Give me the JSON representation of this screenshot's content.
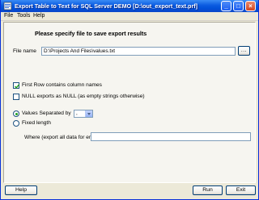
{
  "window": {
    "title": "Export Table to Text for SQL Server DEMO [D:\\out_export_text.prf]"
  },
  "menu": {
    "items": [
      "File",
      "Tools",
      "Help"
    ]
  },
  "main": {
    "heading": "Please specify file to save export results",
    "file_name_label": "File name",
    "file_name_value": "D:\\Projects And Files\\values.txt",
    "browse_label": "...",
    "first_row_label": "First Row contains column names",
    "first_row_checked": true,
    "null_label": "NULL exports as NULL (as empty strings otherwise)",
    "null_checked": false,
    "separated_label": "Values Separated by",
    "separated_value": ",",
    "separated_selected": true,
    "fixed_label": "Fixed length",
    "where_label": "Where (export all data for empty)",
    "where_value": ""
  },
  "footer": {
    "help_label": "Help",
    "run_label": "Run",
    "exit_label": "Exit"
  }
}
